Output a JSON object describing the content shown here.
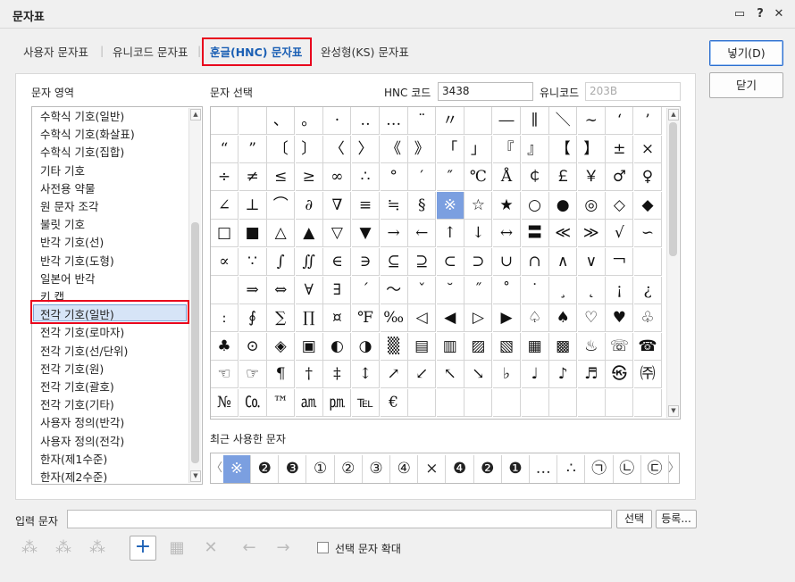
{
  "window": {
    "title": "문자표",
    "help_glyph": "?",
    "close_glyph": "✕",
    "comment_glyph": "▭"
  },
  "tabs": [
    "사용자 문자표",
    "유니코드 문자표",
    "훈글(HNC) 문자표",
    "완성형(KS) 문자표"
  ],
  "active_tab": 2,
  "area_label": "문자 영역",
  "select_label": "문자 선택",
  "hnc_label": "HNC 코드",
  "hnc_value": "3438",
  "unicode_label": "유니코드",
  "unicode_value": "203B",
  "categories": [
    "수학식 기호(일반)",
    "수학식 기호(화살표)",
    "수학식 기호(집합)",
    "기타 기호",
    "사전용 약물",
    "원 문자 조각",
    "불릿 기호",
    "반각 기호(선)",
    "반각 기호(도형)",
    "일본어 반각",
    "키 캡",
    "전각 기호(일반)",
    "전각 기호(로마자)",
    "전각 기호(선/단위)",
    "전각 기호(원)",
    "전각 기호(괄호)",
    "전각 기호(기타)",
    "사용자 정의(반각)",
    "사용자 정의(전각)",
    "한자(제1수준)",
    "한자(제2수준)"
  ],
  "selected_category": 11,
  "chars": [
    [
      "",
      " ",
      "、",
      "。",
      "·",
      "‥",
      "…",
      "¨",
      "〃",
      "",
      "―",
      "∥",
      "＼",
      "∼",
      "‘",
      "’"
    ],
    [
      "“",
      "”",
      "〔",
      "〕",
      "〈",
      "〉",
      "《",
      "》",
      "「",
      "」",
      "『",
      "』",
      "【",
      "】",
      "±",
      "×"
    ],
    [
      "÷",
      "≠",
      "≤",
      "≥",
      "∞",
      "∴",
      "°",
      "′",
      "″",
      "℃",
      "Å",
      "￠",
      "￡",
      "￥",
      "♂",
      "♀"
    ],
    [
      "∠",
      "⊥",
      "⌒",
      "∂",
      "∇",
      "≡",
      "≒",
      "§",
      "※",
      "☆",
      "★",
      "○",
      "●",
      "◎",
      "◇",
      "◆"
    ],
    [
      "□",
      "■",
      "△",
      "▲",
      "▽",
      "▼",
      "→",
      "←",
      "↑",
      "↓",
      "↔",
      "〓",
      "≪",
      "≫",
      "√",
      "∽"
    ],
    [
      "∝",
      "∵",
      "∫",
      "∬",
      "∈",
      "∋",
      "⊆",
      "⊇",
      "⊂",
      "⊃",
      "∪",
      "∩",
      "∧",
      "∨",
      "￢",
      ""
    ],
    [
      "",
      "⇒",
      "⇔",
      "∀",
      "∃",
      "´",
      "～",
      "ˇ",
      "˘",
      "˝",
      "˚",
      "˙",
      "¸",
      "˛",
      "¡",
      "¿"
    ],
    [
      "ː",
      "∮",
      "∑",
      "∏",
      "¤",
      "℉",
      "‰",
      "◁",
      "◀",
      "▷",
      "▶",
      "♤",
      "♠",
      "♡",
      "♥",
      "♧"
    ],
    [
      "♣",
      "⊙",
      "◈",
      "▣",
      "◐",
      "◑",
      "▒",
      "▤",
      "▥",
      "▨",
      "▧",
      "▦",
      "▩",
      "♨",
      "☏",
      "☎"
    ],
    [
      "☜",
      "☞",
      "¶",
      "†",
      "‡",
      "↕",
      "↗",
      "↙",
      "↖",
      "↘",
      "♭",
      "♩",
      "♪",
      "♬",
      "㉿",
      "㈜"
    ],
    [
      "№",
      "㏇",
      "™",
      "㏂",
      "㏘",
      "℡",
      "€",
      "",
      "",
      "",
      "",
      "",
      "",
      "",
      "",
      ""
    ]
  ],
  "selected_char": "※",
  "recent_label": "최근 사용한 문자",
  "recent": [
    "※",
    "❷",
    "❸",
    "①",
    "②",
    "③",
    "④",
    "×",
    "❹",
    "❷",
    "❶",
    "…",
    "∴",
    "㉠",
    "㉡",
    "㉢"
  ],
  "input_label": "입력 문자",
  "input_value": "",
  "buttons": {
    "insert": "넣기(D)",
    "close": "닫기",
    "select": "선택",
    "register": "등록..."
  },
  "zoom_label": "선택 문자 확대",
  "zoom_checked": false
}
